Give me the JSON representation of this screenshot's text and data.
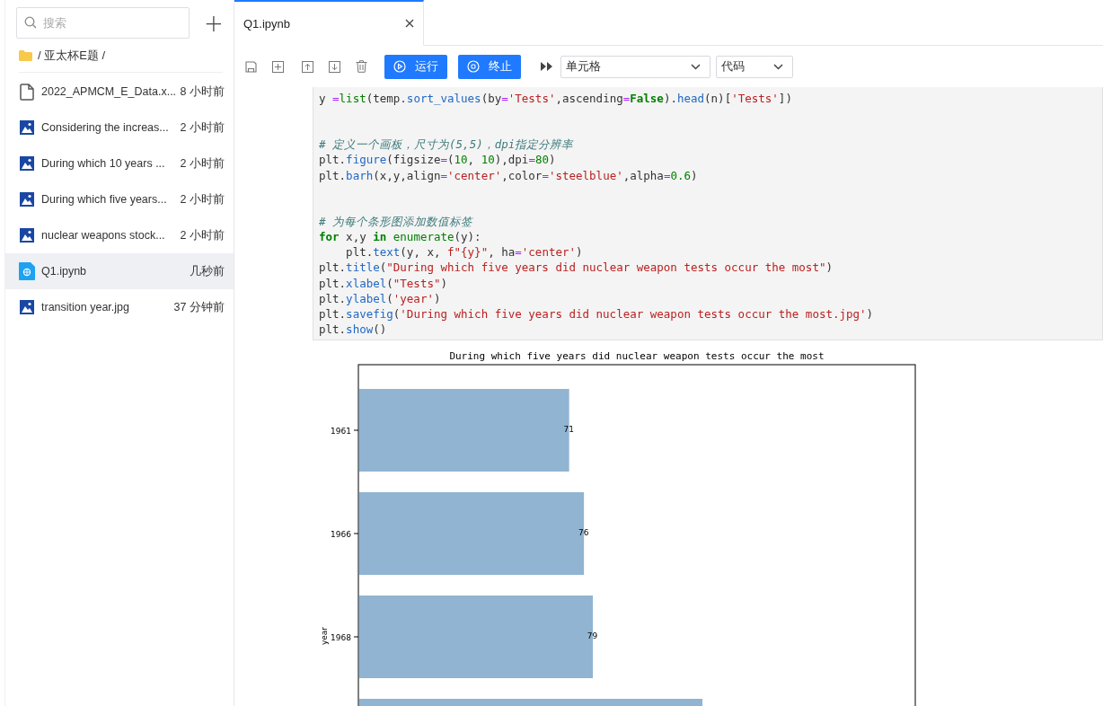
{
  "sidebar": {
    "search": {
      "placeholder": "搜索"
    },
    "add_symbol": "+",
    "breadcrumb": "/ 亚太杯E题 /",
    "files": [
      {
        "kind": "file",
        "name": "2022_APMCM_E_Data.x...",
        "time": "8 小时前",
        "selected": false
      },
      {
        "kind": "image",
        "name": "Considering the increas...",
        "time": "2 小时前",
        "selected": false
      },
      {
        "kind": "image",
        "name": "During which 10 years ...",
        "time": "2 小时前",
        "selected": false
      },
      {
        "kind": "image",
        "name": "During which five years...",
        "time": "2 小时前",
        "selected": false
      },
      {
        "kind": "image",
        "name": "nuclear weapons stock...",
        "time": "2 小时前",
        "selected": false
      },
      {
        "kind": "notebook",
        "name": "Q1.ipynb",
        "time": "几秒前",
        "selected": true
      },
      {
        "kind": "image",
        "name": "transition year.jpg",
        "time": "37 分钟前",
        "selected": false
      }
    ]
  },
  "tabs": [
    {
      "label": "Q1.ipynb",
      "selected": true
    }
  ],
  "toolbar": {
    "run_button": "运行",
    "stop_button": "终止",
    "cell_select": "单元格",
    "type_select": "代码"
  },
  "cell": {
    "blocks": [
      [
        [
          {
            "t": "y ",
            "kind": "plain"
          },
          {
            "t": "=",
            "kind": "op"
          },
          {
            "t": "list",
            "kind": "builtin"
          },
          {
            "t": "(temp.",
            "kind": "plain"
          },
          {
            "t": "sort_values",
            "kind": "func"
          },
          {
            "t": "(by",
            "kind": "plain"
          },
          {
            "t": "=",
            "kind": "op"
          },
          {
            "t": "'Tests'",
            "kind": "str"
          },
          {
            "t": ",ascending",
            "kind": "plain"
          },
          {
            "t": "=",
            "kind": "op"
          },
          {
            "t": "False",
            "kind": "kw"
          },
          {
            "t": ").",
            "kind": "plain"
          },
          {
            "t": "head",
            "kind": "func"
          },
          {
            "t": "(n)[",
            "kind": "plain"
          },
          {
            "t": "'Tests'",
            "kind": "str"
          },
          {
            "t": "])",
            "kind": "plain"
          }
        ]
      ],
      [
        [
          {
            "t": "# 定义一个画板，尺寸为(5,5)，dpi指定分辨率",
            "kind": "comment"
          }
        ],
        [
          {
            "t": "plt.",
            "kind": "plain"
          },
          {
            "t": "figure",
            "kind": "func"
          },
          {
            "t": "(figsize",
            "kind": "plain"
          },
          {
            "t": "=",
            "kind": "op"
          },
          {
            "t": "(",
            "kind": "plain"
          },
          {
            "t": "10",
            "kind": "num"
          },
          {
            "t": ", ",
            "kind": "plain"
          },
          {
            "t": "10",
            "kind": "num"
          },
          {
            "t": "),dpi",
            "kind": "plain"
          },
          {
            "t": "=",
            "kind": "op"
          },
          {
            "t": "80",
            "kind": "num"
          },
          {
            "t": ")",
            "kind": "plain"
          }
        ],
        [
          {
            "t": "plt.",
            "kind": "plain"
          },
          {
            "t": "barh",
            "kind": "func"
          },
          {
            "t": "(x,y,align",
            "kind": "plain"
          },
          {
            "t": "=",
            "kind": "op"
          },
          {
            "t": "'center'",
            "kind": "str"
          },
          {
            "t": ",color",
            "kind": "plain"
          },
          {
            "t": "=",
            "kind": "op"
          },
          {
            "t": "'steelblue'",
            "kind": "str"
          },
          {
            "t": ",alpha",
            "kind": "plain"
          },
          {
            "t": "=",
            "kind": "op"
          },
          {
            "t": "0.6",
            "kind": "num"
          },
          {
            "t": ")",
            "kind": "plain"
          }
        ]
      ],
      [
        [
          {
            "t": "# 为每个条形图添加数值标签",
            "kind": "comment"
          }
        ],
        [
          {
            "t": "for",
            "kind": "kw"
          },
          {
            "t": " x,y ",
            "kind": "plain"
          },
          {
            "t": "in",
            "kind": "kw"
          },
          {
            "t": " enumerate",
            "kind": "builtin"
          },
          {
            "t": "(y):",
            "kind": "plain"
          }
        ],
        [
          {
            "t": "    plt.",
            "kind": "plain"
          },
          {
            "t": "text",
            "kind": "func"
          },
          {
            "t": "(y, x, ",
            "kind": "plain"
          },
          {
            "t": "f\"{y}\"",
            "kind": "str"
          },
          {
            "t": ", ha",
            "kind": "plain"
          },
          {
            "t": "=",
            "kind": "op"
          },
          {
            "t": "'center'",
            "kind": "str"
          },
          {
            "t": ")",
            "kind": "plain"
          }
        ],
        [
          {
            "t": "plt.",
            "kind": "plain"
          },
          {
            "t": "title",
            "kind": "func"
          },
          {
            "t": "(",
            "kind": "plain"
          },
          {
            "t": "\"During which five years did nuclear weapon tests occur the most\"",
            "kind": "str"
          },
          {
            "t": ")",
            "kind": "plain"
          }
        ],
        [
          {
            "t": "plt.",
            "kind": "plain"
          },
          {
            "t": "xlabel",
            "kind": "func"
          },
          {
            "t": "(",
            "kind": "plain"
          },
          {
            "t": "\"Tests\"",
            "kind": "str"
          },
          {
            "t": ")",
            "kind": "plain"
          }
        ],
        [
          {
            "t": "plt.",
            "kind": "plain"
          },
          {
            "t": "ylabel",
            "kind": "func"
          },
          {
            "t": "(",
            "kind": "plain"
          },
          {
            "t": "'year'",
            "kind": "str"
          },
          {
            "t": ")",
            "kind": "plain"
          }
        ],
        [
          {
            "t": "plt.",
            "kind": "plain"
          },
          {
            "t": "savefig",
            "kind": "func"
          },
          {
            "t": "(",
            "kind": "plain"
          },
          {
            "t": "'During which five years did nuclear weapon tests occur the most.jpg'",
            "kind": "str"
          },
          {
            "t": ")",
            "kind": "plain"
          }
        ],
        [
          {
            "t": "plt.",
            "kind": "plain"
          },
          {
            "t": "show",
            "kind": "func"
          },
          {
            "t": "()",
            "kind": "plain"
          }
        ]
      ]
    ]
  },
  "output": {
    "chart_data": {
      "type": "bar",
      "orientation": "horizontal",
      "title": "During which five years did nuclear weapon tests occur the most",
      "ylabel": "year",
      "categories": [
        "1961",
        "1966",
        "1968",
        null
      ],
      "values": [
        71,
        76,
        79,
        116
      ],
      "xlim": [
        0,
        188
      ],
      "value_labels": [
        "71",
        "76",
        "79",
        null
      ]
    }
  }
}
